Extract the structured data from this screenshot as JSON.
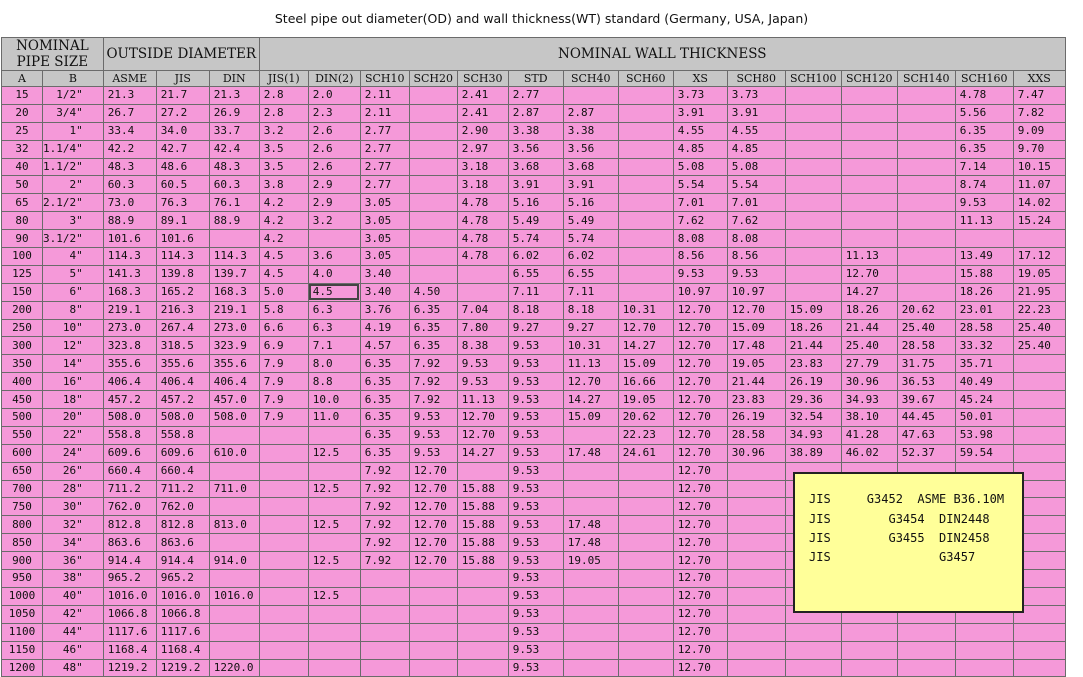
{
  "title": "Steel pipe out  diameter(OD) and wall thickness(WT) standard     (Germany, USA, Japan)",
  "header": {
    "nominal_pipe_size": "NOMINAL PIPE SIZE",
    "outside_diameter": "OUTSIDE DIAMETER",
    "nominal_wall_thickness": "NOMINAL WALL THICKNESS",
    "columns": [
      "A",
      "B",
      "ASME",
      "JIS",
      "DIN",
      "JIS(1)",
      "DIN(2)",
      "SCH10",
      "SCH20",
      "SCH30",
      "STD",
      "SCH40",
      "SCH60",
      "XS",
      "SCH80",
      "SCH100",
      "SCH120",
      "SCH140",
      "SCH160",
      "XXS"
    ]
  },
  "rows": [
    [
      "15",
      "1/2\"",
      "21.3",
      "21.7",
      "21.3",
      "2.8",
      "2.0",
      "2.11",
      "",
      "2.41",
      "2.77",
      "",
      "",
      "3.73",
      "3.73",
      "",
      "",
      "",
      "4.78",
      "7.47"
    ],
    [
      "20",
      "3/4\"",
      "26.7",
      "27.2",
      "26.9",
      "2.8",
      "2.3",
      "2.11",
      "",
      "2.41",
      "2.87",
      "2.87",
      "",
      "3.91",
      "3.91",
      "",
      "",
      "",
      "5.56",
      "7.82"
    ],
    [
      "25",
      "1\"",
      "33.4",
      "34.0",
      "33.7",
      "3.2",
      "2.6",
      "2.77",
      "",
      "2.90",
      "3.38",
      "3.38",
      "",
      "4.55",
      "4.55",
      "",
      "",
      "",
      "6.35",
      "9.09"
    ],
    [
      "32",
      "1.1/4\"",
      "42.2",
      "42.7",
      "42.4",
      "3.5",
      "2.6",
      "2.77",
      "",
      "2.97",
      "3.56",
      "3.56",
      "",
      "4.85",
      "4.85",
      "",
      "",
      "",
      "6.35",
      "9.70"
    ],
    [
      "40",
      "1.1/2\"",
      "48.3",
      "48.6",
      "48.3",
      "3.5",
      "2.6",
      "2.77",
      "",
      "3.18",
      "3.68",
      "3.68",
      "",
      "5.08",
      "5.08",
      "",
      "",
      "",
      "7.14",
      "10.15"
    ],
    [
      "50",
      "2\"",
      "60.3",
      "60.5",
      "60.3",
      "3.8",
      "2.9",
      "2.77",
      "",
      "3.18",
      "3.91",
      "3.91",
      "",
      "5.54",
      "5.54",
      "",
      "",
      "",
      "8.74",
      "11.07"
    ],
    [
      "65",
      "2.1/2\"",
      "73.0",
      "76.3",
      "76.1",
      "4.2",
      "2.9",
      "3.05",
      "",
      "4.78",
      "5.16",
      "5.16",
      "",
      "7.01",
      "7.01",
      "",
      "",
      "",
      "9.53",
      "14.02"
    ],
    [
      "80",
      "3\"",
      "88.9",
      "89.1",
      "88.9",
      "4.2",
      "3.2",
      "3.05",
      "",
      "4.78",
      "5.49",
      "5.49",
      "",
      "7.62",
      "7.62",
      "",
      "",
      "",
      "11.13",
      "15.24"
    ],
    [
      "90",
      "3.1/2\"",
      "101.6",
      "101.6",
      "",
      "4.2",
      "",
      "3.05",
      "",
      "4.78",
      "5.74",
      "5.74",
      "",
      "8.08",
      "8.08",
      "",
      "",
      "",
      "",
      ""
    ],
    [
      "100",
      "4\"",
      "114.3",
      "114.3",
      "114.3",
      "4.5",
      "3.6",
      "3.05",
      "",
      "4.78",
      "6.02",
      "6.02",
      "",
      "8.56",
      "8.56",
      "",
      "11.13",
      "",
      "13.49",
      "17.12"
    ],
    [
      "125",
      "5\"",
      "141.3",
      "139.8",
      "139.7",
      "4.5",
      "4.0",
      "3.40",
      "",
      "",
      "6.55",
      "6.55",
      "",
      "9.53",
      "9.53",
      "",
      "12.70",
      "",
      "15.88",
      "19.05"
    ],
    [
      "150",
      "6\"",
      "168.3",
      "165.2",
      "168.3",
      "5.0",
      "4.5",
      "3.40",
      "4.50",
      "",
      "7.11",
      "7.11",
      "",
      "10.97",
      "10.97",
      "",
      "14.27",
      "",
      "18.26",
      "21.95"
    ],
    [
      "200",
      "8\"",
      "219.1",
      "216.3",
      "219.1",
      "5.8",
      "6.3",
      "3.76",
      "6.35",
      "7.04",
      "8.18",
      "8.18",
      "10.31",
      "12.70",
      "12.70",
      "15.09",
      "18.26",
      "20.62",
      "23.01",
      "22.23"
    ],
    [
      "250",
      "10\"",
      "273.0",
      "267.4",
      "273.0",
      "6.6",
      "6.3",
      "4.19",
      "6.35",
      "7.80",
      "9.27",
      "9.27",
      "12.70",
      "12.70",
      "15.09",
      "18.26",
      "21.44",
      "25.40",
      "28.58",
      "25.40"
    ],
    [
      "300",
      "12\"",
      "323.8",
      "318.5",
      "323.9",
      "6.9",
      "7.1",
      "4.57",
      "6.35",
      "8.38",
      "9.53",
      "10.31",
      "14.27",
      "12.70",
      "17.48",
      "21.44",
      "25.40",
      "28.58",
      "33.32",
      "25.40"
    ],
    [
      "350",
      "14\"",
      "355.6",
      "355.6",
      "355.6",
      "7.9",
      "8.0",
      "6.35",
      "7.92",
      "9.53",
      "9.53",
      "11.13",
      "15.09",
      "12.70",
      "19.05",
      "23.83",
      "27.79",
      "31.75",
      "35.71",
      ""
    ],
    [
      "400",
      "16\"",
      "406.4",
      "406.4",
      "406.4",
      "7.9",
      "8.8",
      "6.35",
      "7.92",
      "9.53",
      "9.53",
      "12.70",
      "16.66",
      "12.70",
      "21.44",
      "26.19",
      "30.96",
      "36.53",
      "40.49",
      ""
    ],
    [
      "450",
      "18\"",
      "457.2",
      "457.2",
      "457.0",
      "7.9",
      "10.0",
      "6.35",
      "7.92",
      "11.13",
      "9.53",
      "14.27",
      "19.05",
      "12.70",
      "23.83",
      "29.36",
      "34.93",
      "39.67",
      "45.24",
      ""
    ],
    [
      "500",
      "20\"",
      "508.0",
      "508.0",
      "508.0",
      "7.9",
      "11.0",
      "6.35",
      "9.53",
      "12.70",
      "9.53",
      "15.09",
      "20.62",
      "12.70",
      "26.19",
      "32.54",
      "38.10",
      "44.45",
      "50.01",
      ""
    ],
    [
      "550",
      "22\"",
      "558.8",
      "558.8",
      "",
      "",
      "",
      "6.35",
      "9.53",
      "12.70",
      "9.53",
      "",
      "22.23",
      "12.70",
      "28.58",
      "34.93",
      "41.28",
      "47.63",
      "53.98",
      ""
    ],
    [
      "600",
      "24\"",
      "609.6",
      "609.6",
      "610.0",
      "",
      "12.5",
      "6.35",
      "9.53",
      "14.27",
      "9.53",
      "17.48",
      "24.61",
      "12.70",
      "30.96",
      "38.89",
      "46.02",
      "52.37",
      "59.54",
      ""
    ],
    [
      "650",
      "26\"",
      "660.4",
      "660.4",
      "",
      "",
      "",
      "7.92",
      "12.70",
      "",
      "9.53",
      "",
      "",
      "12.70",
      "",
      "",
      "",
      "",
      "",
      ""
    ],
    [
      "700",
      "28\"",
      "711.2",
      "711.2",
      "711.0",
      "",
      "12.5",
      "7.92",
      "12.70",
      "15.88",
      "9.53",
      "",
      "",
      "12.70",
      "",
      "",
      "",
      "",
      "",
      ""
    ],
    [
      "750",
      "30\"",
      "762.0",
      "762.0",
      "",
      "",
      "",
      "7.92",
      "12.70",
      "15.88",
      "9.53",
      "",
      "",
      "12.70",
      "",
      "",
      "",
      "",
      "",
      ""
    ],
    [
      "800",
      "32\"",
      "812.8",
      "812.8",
      "813.0",
      "",
      "12.5",
      "7.92",
      "12.70",
      "15.88",
      "9.53",
      "17.48",
      "",
      "12.70",
      "",
      "",
      "",
      "",
      "",
      ""
    ],
    [
      "850",
      "34\"",
      "863.6",
      "863.6",
      "",
      "",
      "",
      "7.92",
      "12.70",
      "15.88",
      "9.53",
      "17.48",
      "",
      "12.70",
      "",
      "",
      "",
      "",
      "",
      ""
    ],
    [
      "900",
      "36\"",
      "914.4",
      "914.4",
      "914.0",
      "",
      "12.5",
      "7.92",
      "12.70",
      "15.88",
      "9.53",
      "19.05",
      "",
      "12.70",
      "",
      "",
      "",
      "",
      "",
      ""
    ],
    [
      "950",
      "38\"",
      "965.2",
      "965.2",
      "",
      "",
      "",
      "",
      "",
      "",
      "9.53",
      "",
      "",
      "12.70",
      "",
      "",
      "",
      "",
      "",
      ""
    ],
    [
      "1000",
      "40\"",
      "1016.0",
      "1016.0",
      "1016.0",
      "",
      "12.5",
      "",
      "",
      "",
      "9.53",
      "",
      "",
      "12.70",
      "",
      "",
      "",
      "",
      "",
      ""
    ],
    [
      "1050",
      "42\"",
      "1066.8",
      "1066.8",
      "",
      "",
      "",
      "",
      "",
      "",
      "9.53",
      "",
      "",
      "12.70",
      "",
      "",
      "",
      "",
      "",
      ""
    ],
    [
      "1100",
      "44\"",
      "1117.6",
      "1117.6",
      "",
      "",
      "",
      "",
      "",
      "",
      "9.53",
      "",
      "",
      "12.70",
      "",
      "",
      "",
      "",
      "",
      ""
    ],
    [
      "1150",
      "46\"",
      "1168.4",
      "1168.4",
      "",
      "",
      "",
      "",
      "",
      "",
      "9.53",
      "",
      "",
      "12.70",
      "",
      "",
      "",
      "",
      "",
      ""
    ],
    [
      "1200",
      "48\"",
      "1219.2",
      "1219.2",
      "1220.0",
      "",
      "",
      "",
      "",
      "",
      "9.53",
      "",
      "",
      "12.70",
      "",
      "",
      "",
      "",
      "",
      ""
    ]
  ],
  "selected_cell": "4.5",
  "legend": {
    "line1": "JIS     G3452  ASME B36.10M",
    "line2": "JIS        G3454  DIN2448",
    "line3": "JIS        G3455  DIN2458",
    "line4": "JIS               G3457"
  },
  "colors": {
    "header_bg": "#c6c6c6",
    "row_bg": "#f599d9",
    "legend_bg": "#ffff99"
  }
}
